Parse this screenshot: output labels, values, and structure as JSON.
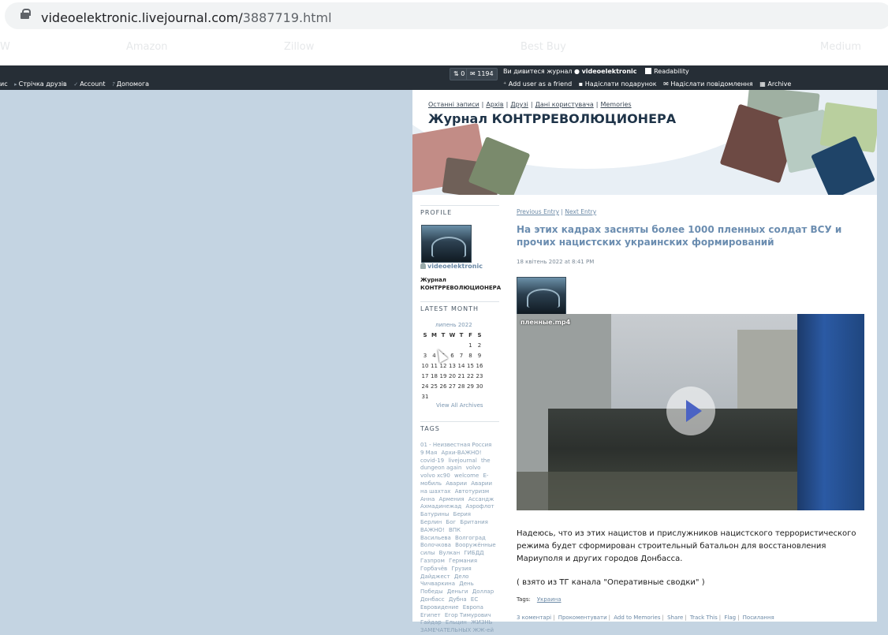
{
  "browser": {
    "url_host": "videoelektronic.livejournal.com/",
    "url_path": "3887719.html",
    "bookmark_ghosts": [
      "W",
      "Amazon",
      "Zillow",
      "Best Buy",
      "Medium"
    ]
  },
  "lj_nav": {
    "left_items": [
      "ис",
      "Стрічка друзів",
      "Account",
      "Допомога"
    ],
    "counter_a": "0",
    "counter_b": "1194",
    "viewing_prefix": "Ви дивитеся журнал",
    "viewing_user": "videoelektronic",
    "readability": "Readability",
    "actions": [
      "Add user as a friend",
      "Надіслати подарунок",
      "Надіслати повідомлення",
      "Archive"
    ]
  },
  "journal": {
    "links": [
      "Останні записи",
      "Архів",
      "Друзі",
      "Дані користувача",
      "Memories"
    ],
    "title": "Журнал КОНТРРЕВОЛЮЦИОНЕРА"
  },
  "sidebar": {
    "profile_head": "PROFILE",
    "username": "videoelektronic",
    "journal_title": "Журнал КОНТРРЕВОЛЮЦИОНЕРА",
    "latest_month_head": "LATEST MONTH",
    "month": "липень 2022",
    "weekdays": [
      "S",
      "M",
      "T",
      "W",
      "T",
      "F",
      "S"
    ],
    "weeks": [
      [
        "",
        "",
        "",
        "",
        "",
        "1",
        "2"
      ],
      [
        "3",
        "4",
        "5",
        "6",
        "7",
        "8",
        "9"
      ],
      [
        "10",
        "11",
        "12",
        "13",
        "14",
        "15",
        "16"
      ],
      [
        "17",
        "18",
        "19",
        "20",
        "21",
        "22",
        "23"
      ],
      [
        "24",
        "25",
        "26",
        "27",
        "28",
        "29",
        "30"
      ],
      [
        "31",
        "",
        "",
        "",
        "",
        "",
        ""
      ]
    ],
    "view_all": "View All Archives",
    "tags_head": "TAGS",
    "tags": [
      "01 - Неизвестная Россия",
      "9 Мая",
      "Архи-ВАЖНО!",
      "covid-19",
      "livejournal",
      "the dungeon again",
      "volvo",
      "volvo xc90",
      "welcome",
      "Е-мобиль",
      "Аварии",
      "Аварии на шахтах",
      "Автотуризм",
      "Анна",
      "Армения",
      "Ассандж",
      "Ахмадинежад",
      "Аэрофлот",
      "Батурины",
      "Берия",
      "Берлин",
      "Бог",
      "Британия",
      "ВАЖНО!",
      "ВПК",
      "Васильева",
      "Волгоград",
      "Волочкова",
      "Вооружённые силы",
      "Вулкан",
      "ГИБДД",
      "Газпром",
      "Германия",
      "Горбачёв",
      "Грузия",
      "Дайджест",
      "Дело Чичваркина",
      "День Победы",
      "Деньги",
      "Доллар",
      "Донбасс",
      "Дубна",
      "ЕС",
      "Евровидение",
      "Европа",
      "Египет",
      "Егор Тимурович Гайдар",
      "Ельцин",
      "ЖИЗНЬ ЗАМЕЧАТЕЛЬНЫХ ЖЖ-ей"
    ]
  },
  "entry": {
    "prev": "Previous Entry",
    "next": "Next Entry",
    "title": "На этих кадрах засняты более 1000 пленных солдат ВСУ и прочих нацистских украинских формирований",
    "date": "18 квітень 2022 at 8:41 PM",
    "video_filename": "пленные.mp4",
    "body": "Надеюсь, что из этих нацистов и прислужников нацистского террористического режима будет сформирован строительный батальон для восстановления Мариуполя и других городов Донбасса.",
    "source": "( взято из ТГ канала \"Оперативные сводки\" )",
    "tags_label": "Tags:",
    "tag": "Украина",
    "footer": [
      "3 коментарі",
      "Прокоментувати",
      "Add to Memories",
      "Share",
      "Track This",
      "Flag",
      "Посилання"
    ]
  }
}
